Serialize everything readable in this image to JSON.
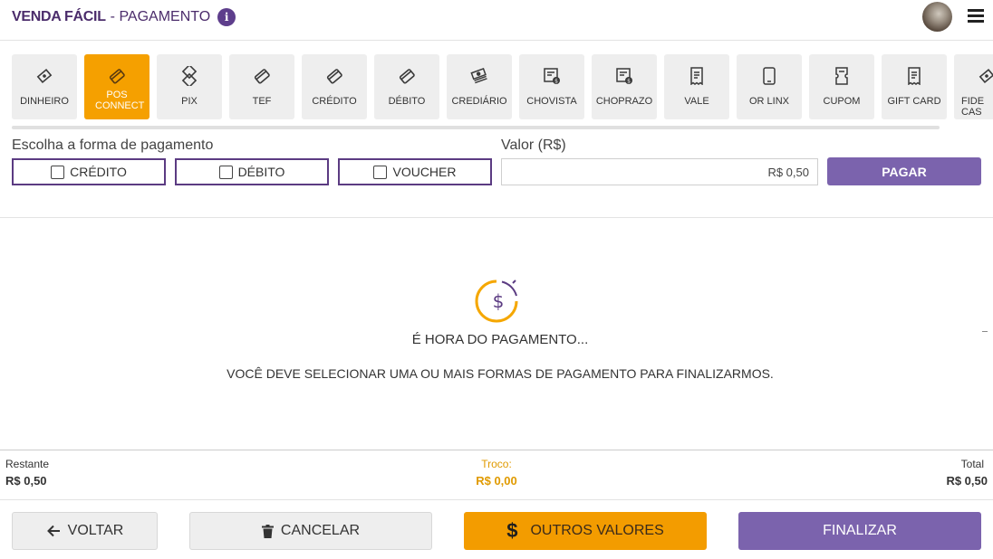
{
  "header": {
    "brand": "VENDA FÁCIL",
    "page": "- PAGAMENTO",
    "info_icon": "i"
  },
  "colors": {
    "brand_purple": "#4b2c6b",
    "accent_purple": "#7b63ad",
    "accent_orange": "#f39c00"
  },
  "payment_methods": [
    {
      "label": "DINHEIRO",
      "icon": "cash-icon",
      "active": false
    },
    {
      "label": "POS CONNECT",
      "icon": "card-icon",
      "active": true
    },
    {
      "label": "PIX",
      "icon": "pix-icon",
      "active": false
    },
    {
      "label": "TEF",
      "icon": "card-icon",
      "active": false
    },
    {
      "label": "CRÉDITO",
      "icon": "card-icon",
      "active": false
    },
    {
      "label": "DÉBITO",
      "icon": "card-icon",
      "active": false
    },
    {
      "label": "CREDIÁRIO",
      "icon": "money-stack-icon",
      "active": false
    },
    {
      "label": "CHOVISTA",
      "icon": "check-receipt-icon",
      "active": false
    },
    {
      "label": "CHOPRAZO",
      "icon": "check-receipt-icon",
      "active": false
    },
    {
      "label": "VALE",
      "icon": "receipt-icon",
      "active": false
    },
    {
      "label": "OR LINX",
      "icon": "phone-icon",
      "active": false
    },
    {
      "label": "CUPOM",
      "icon": "coupon-icon",
      "active": false
    },
    {
      "label": "GIFT CARD",
      "icon": "receipt-icon",
      "active": false
    },
    {
      "label": "FIDE CAS",
      "icon": "cash-icon",
      "active": false
    }
  ],
  "form": {
    "choose_label": "Escolha a forma de pagamento",
    "options": [
      "CRÉDITO",
      "DÉBITO",
      "VOUCHER"
    ],
    "value_label": "Valor (R$)",
    "value": "R$ 0,50",
    "pay_label": "PAGAR"
  },
  "hero": {
    "icon": "dollar-clock-icon",
    "title": "É HORA DO PAGAMENTO...",
    "text": "VOCÊ DEVE SELECIONAR UMA OU MAIS FORMAS DE PAGAMENTO PARA FINALIZARMOS."
  },
  "totals": {
    "restante_label": "Restante",
    "restante_value": "R$ 0,50",
    "troco_label": "Troco:",
    "troco_value": "R$ 0,00",
    "total_label": "Total",
    "total_value": "R$ 0,50"
  },
  "actions": {
    "back": "VOLTAR",
    "cancel": "CANCELAR",
    "other": "OUTROS VALORES",
    "finish": "FINALIZAR"
  }
}
